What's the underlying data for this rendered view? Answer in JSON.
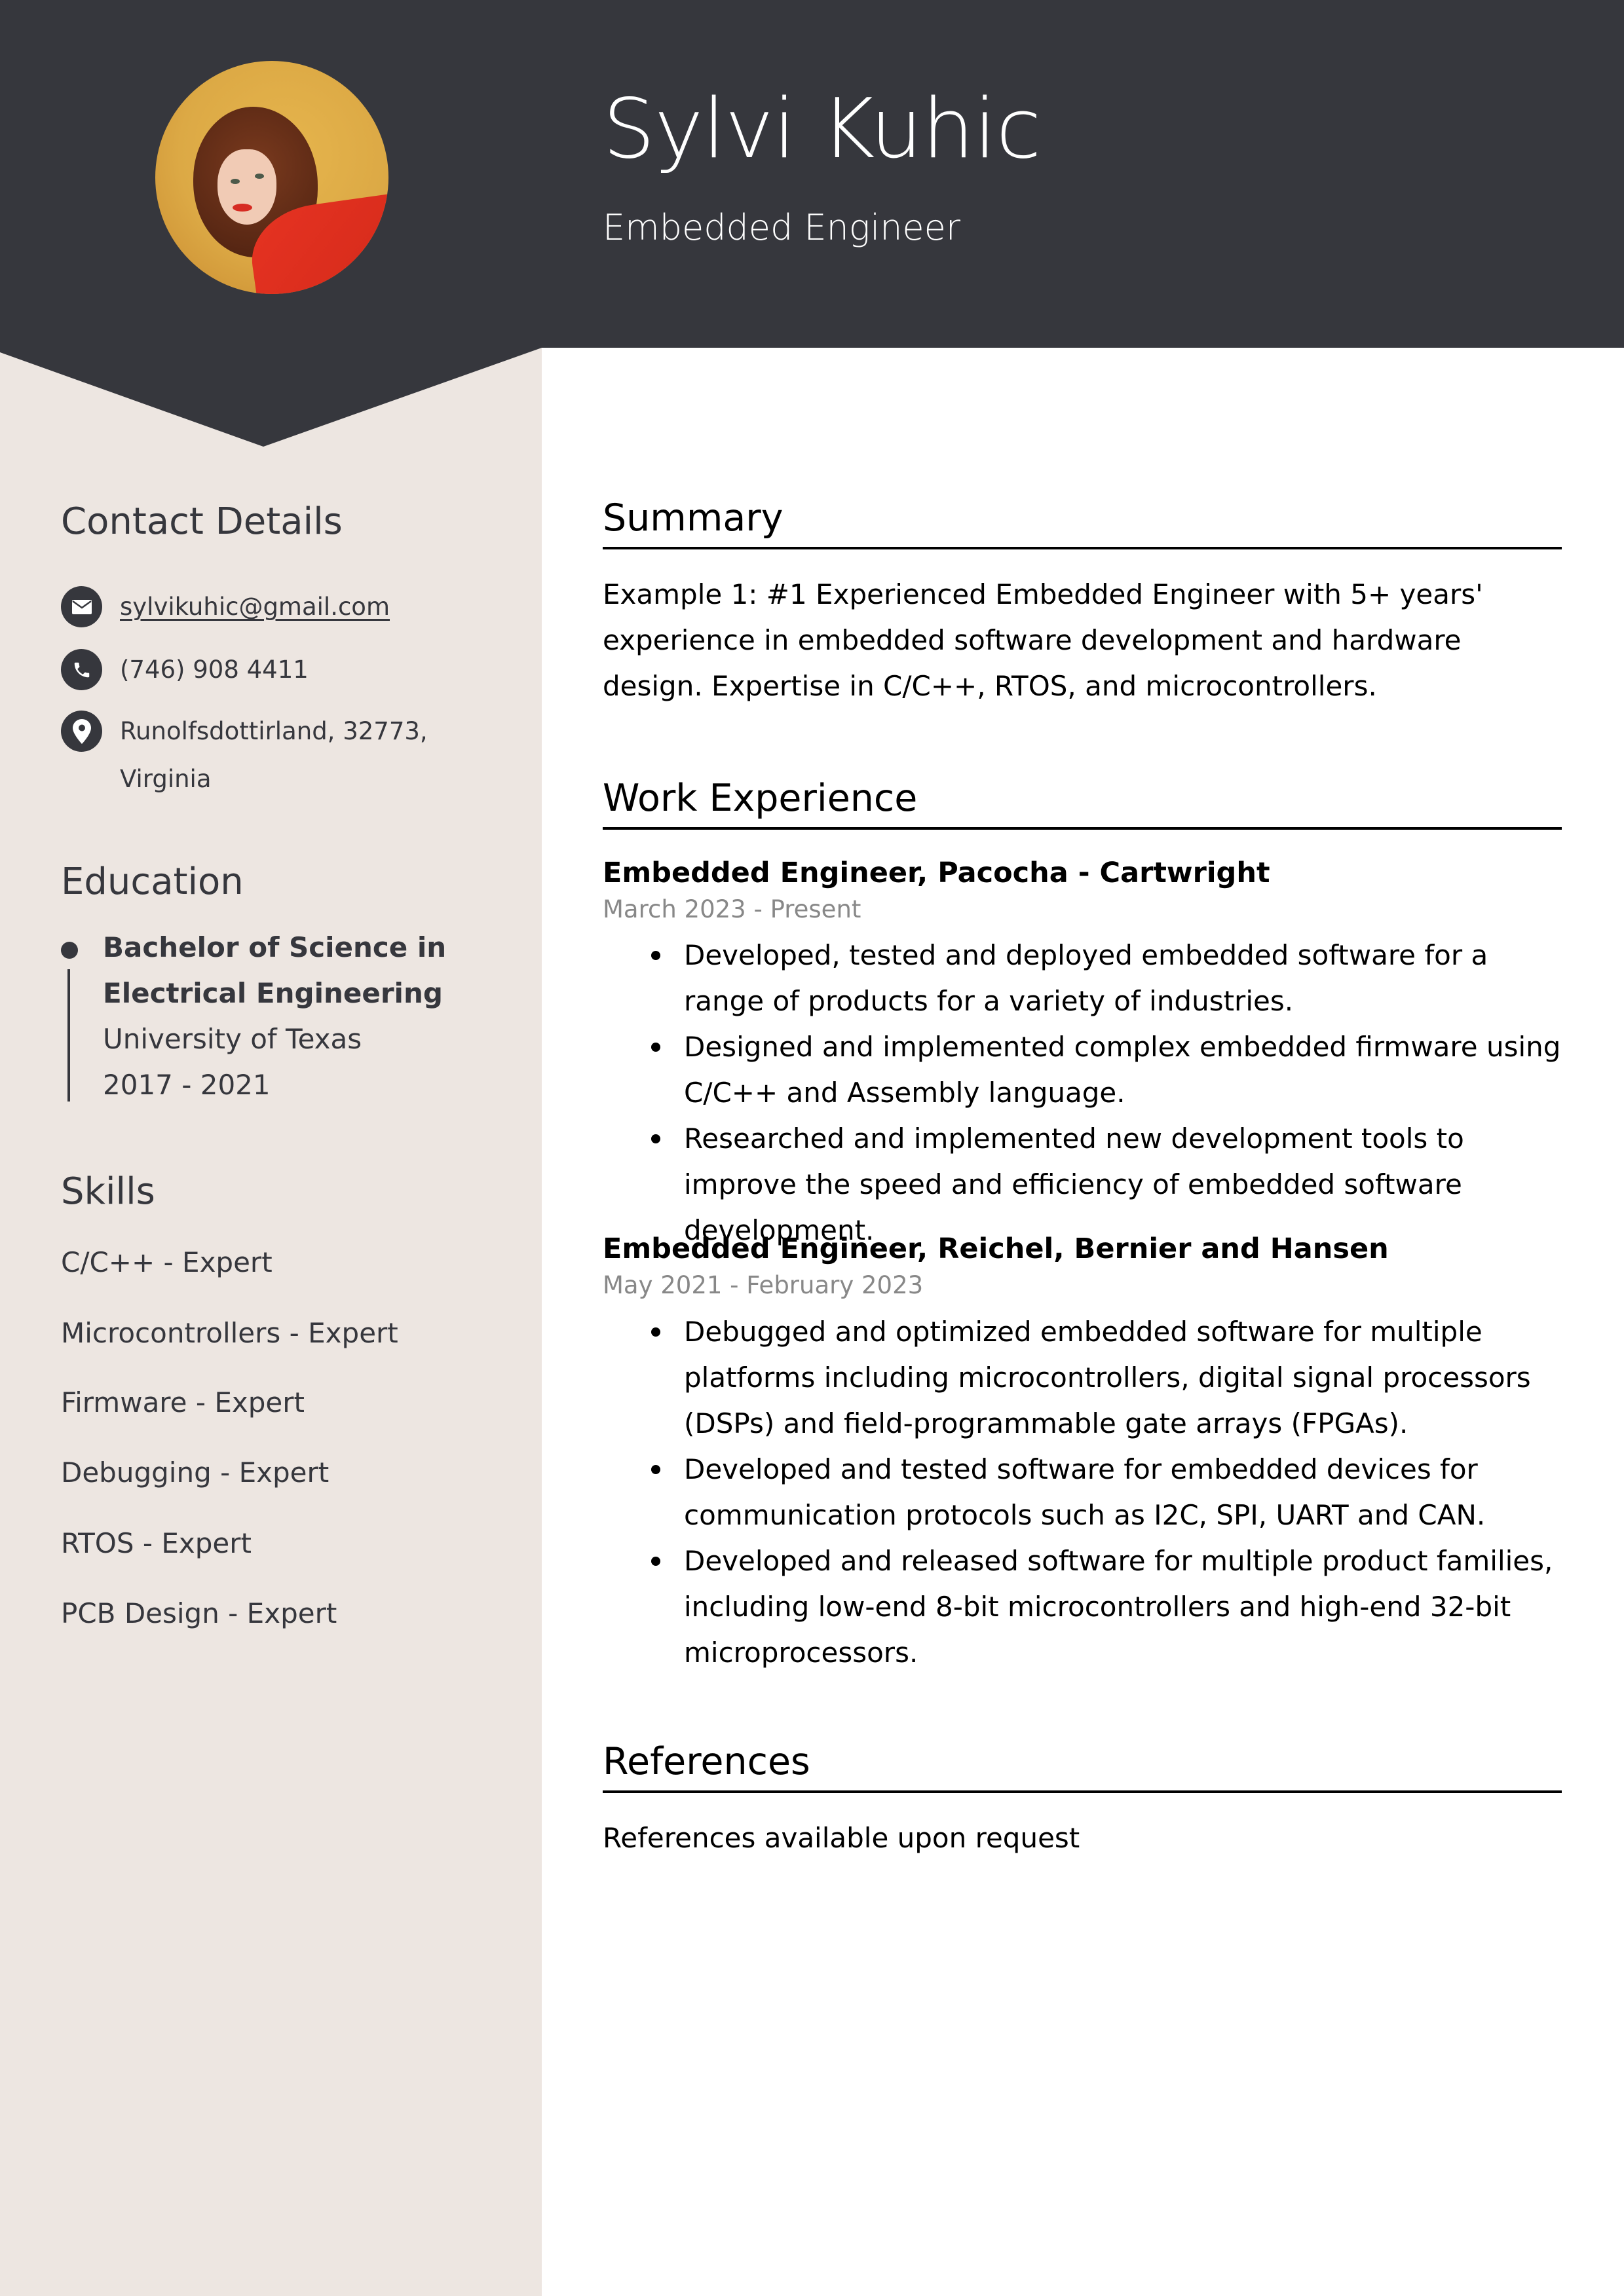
{
  "header": {
    "name": "Sylvi Kuhic",
    "title": "Embedded Engineer",
    "photo_icon": "profile-photo"
  },
  "colors": {
    "header_bg": "#36373d",
    "sidebar_bg": "#ede6e1",
    "text_dark": "#36373d",
    "date_gray": "#888888"
  },
  "sidebar": {
    "contact": {
      "heading": "Contact Details",
      "email": {
        "icon": "envelope-icon",
        "value": "sylvikuhic@gmail.com"
      },
      "phone": {
        "icon": "phone-icon",
        "value": "(746) 908 4411"
      },
      "address": {
        "icon": "location-pin-icon",
        "line1": "Runolfsdottirland, 32773,",
        "line2": "Virginia"
      }
    },
    "education": {
      "heading": "Education",
      "items": [
        {
          "degree_line1": "Bachelor of Science in",
          "degree_line2": "Electrical Engineering",
          "school": "University of Texas",
          "years": "2017 - 2021"
        }
      ]
    },
    "skills": {
      "heading": "Skills",
      "items": [
        "C/C++ - Expert",
        "Microcontrollers - Expert",
        "Firmware - Expert",
        "Debugging - Expert",
        "RTOS - Expert",
        "PCB Design - Expert"
      ]
    }
  },
  "main": {
    "summary": {
      "heading": "Summary",
      "text": "Example 1: #1 Experienced Embedded Engineer with 5+ years' experience in embedded software development and hardware design. Expertise in C/C++, RTOS, and microcontrollers."
    },
    "experience": {
      "heading": "Work Experience",
      "jobs": [
        {
          "title": "Embedded Engineer, Pacocha - Cartwright",
          "dates": "March 2023 - Present",
          "bullets": [
            "Developed, tested and deployed embedded software for a range of products for a variety of industries.",
            "Designed and implemented complex embedded firmware using C/C++ and Assembly language.",
            "Researched and implemented new development tools to improve the speed and efficiency of embedded software development."
          ]
        },
        {
          "title": "Embedded Engineer, Reichel, Bernier and Hansen",
          "dates": "May 2021 - February 2023",
          "bullets": [
            "Debugged and optimized embedded software for multiple platforms including microcontrollers, digital signal processors (DSPs) and field-programmable gate arrays (FPGAs).",
            "Developed and tested software for embedded devices for communication protocols such as I2C, SPI, UART and CAN.",
            "Developed and released software for multiple product families, including low-end 8-bit microcontrollers and high-end 32-bit microprocessors."
          ]
        }
      ]
    },
    "references": {
      "heading": "References",
      "text": "References available upon request"
    }
  }
}
